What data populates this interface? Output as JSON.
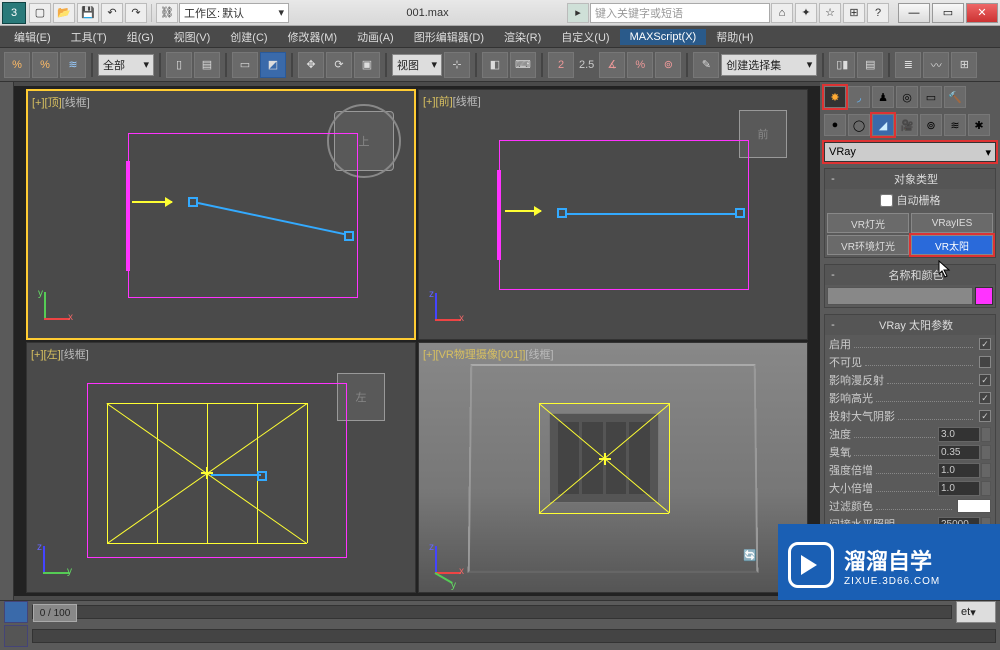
{
  "title": "001.max",
  "workspace": {
    "label": "工作区:",
    "value": "默认"
  },
  "search": {
    "placeholder": "键入关键字或短语"
  },
  "menubar": [
    "编辑(E)",
    "工具(T)",
    "组(G)",
    "视图(V)",
    "创建(C)",
    "修改器(M)",
    "动画(A)",
    "图形编辑器(D)",
    "渲染(R)",
    "自定义(U)",
    "MAXScript(X)",
    "帮助(H)"
  ],
  "toolbar": {
    "sel_filter": "全部",
    "ref_dd": "视图",
    "snap_angle": "2.5",
    "named_set": "创建选择集"
  },
  "viewports": {
    "top": {
      "label_prefix": "[+][顶]",
      "label_mode": "[线框]"
    },
    "front": {
      "label_prefix": "[+][前]",
      "label_mode": "[线框]"
    },
    "left": {
      "label_prefix": "[+][左]",
      "label_mode": "[线框]"
    },
    "persp": {
      "label_prefix": "[+][VR物理摄像[001]]",
      "label_mode": "[线框]"
    },
    "cube_top": "上",
    "cube_front": "前",
    "cube_left": "左"
  },
  "rpanel": {
    "renderer": "VRay",
    "rollout_objtype": "对象类型",
    "autogrid": "自动栅格",
    "buttons": [
      "VR灯光",
      "VRayIES",
      "VR环境灯光",
      "VR太阳"
    ],
    "rollout_name": "名称和颜色",
    "rollout_params": "VRay 太阳参数",
    "params": [
      {
        "label": "启用",
        "type": "checkbox",
        "checked": true
      },
      {
        "label": "不可见",
        "type": "checkbox",
        "checked": false
      },
      {
        "label": "影响漫反射",
        "type": "checkbox",
        "checked": true
      },
      {
        "label": "影响高光",
        "type": "checkbox",
        "checked": true
      },
      {
        "label": "投射大气阴影",
        "type": "checkbox",
        "checked": true
      },
      {
        "label": "浊度",
        "type": "spinner",
        "value": "3.0"
      },
      {
        "label": "臭氧",
        "type": "spinner",
        "value": "0.35"
      },
      {
        "label": "强度倍增",
        "type": "spinner",
        "value": "1.0"
      },
      {
        "label": "大小倍增",
        "type": "spinner",
        "value": "1.0"
      },
      {
        "label": "过滤颜色",
        "type": "swatch"
      },
      {
        "label": "间接水平照明",
        "type": "spinner",
        "value": "25000."
      }
    ],
    "extra_dd": "et"
  },
  "timeline": {
    "frame": "0 / 100"
  },
  "brand": {
    "name": "溜溜自学",
    "url": "ZIXUE.3D66.COM"
  }
}
